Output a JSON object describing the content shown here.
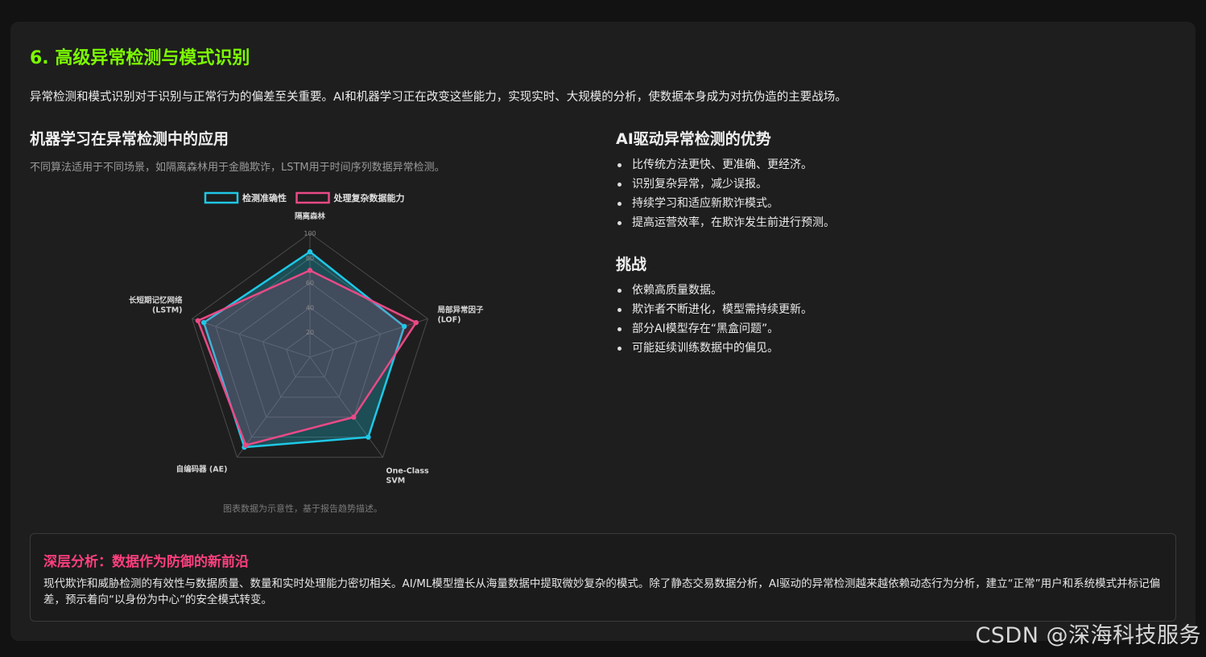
{
  "section": {
    "title": "6. 高级异常检测与模式识别",
    "intro": "异常检测和模式识别对于识别与正常行为的偏差至关重要。AI和机器学习正在改变这些能力，实现实时、大规模的分析，使数据本身成为对抗伪造的主要战场。"
  },
  "left": {
    "title": "机器学习在异常检测中的应用",
    "subtitle": "不同算法适用于不同场景，如隔离森林用于金融欺诈，LSTM用于时间序列数据异常检测。",
    "caption": "图表数据为示意性，基于报告趋势描述。"
  },
  "chart_data": {
    "type": "radar",
    "categories": [
      "隔离森林",
      "局部异常因子 (LOF)",
      "One-Class SVM",
      "自编码器 (AE)",
      "长短期记忆网络 (LSTM)"
    ],
    "category_lines": [
      [
        "隔离森林"
      ],
      [
        "局部异常因子",
        "(LOF)"
      ],
      [
        "One-Class",
        "SVM"
      ],
      [
        "自编码器 (AE)"
      ],
      [
        "长短期记忆网络",
        "(LSTM)"
      ]
    ],
    "ticks": [
      20,
      40,
      60,
      80,
      100
    ],
    "rmax": 100,
    "series": [
      {
        "name": "检测准确性",
        "values": [
          85,
          80,
          80,
          90,
          90
        ],
        "color": "#1ec8e6"
      },
      {
        "name": "处理复杂数据能力",
        "values": [
          70,
          90,
          60,
          88,
          95
        ],
        "color": "#e84a86"
      }
    ],
    "legend_position": "top"
  },
  "right": {
    "advantages_title": "AI驱动异常检测的优势",
    "advantages": [
      "比传统方法更快、更准确、更经济。",
      "识别复杂异常，减少误报。",
      "持续学习和适应新欺诈模式。",
      "提高运营效率，在欺诈发生前进行预测。"
    ],
    "challenges_title": "挑战",
    "challenges": [
      "依赖高质量数据。",
      "欺诈者不断进化，模型需持续更新。",
      "部分AI模型存在“黑盒问题”。",
      "可能延续训练数据中的偏见。"
    ]
  },
  "deep": {
    "title": "深层分析：数据作为防御的新前沿",
    "body": "现代欺诈和威胁检测的有效性与数据质量、数量和实时处理能力密切相关。AI/ML模型擅长从海量数据中提取微妙复杂的模式。除了静态交易数据分析，AI驱动的异常检测越来越依赖动态行为分析，建立“正常”用户和系统模式并标记偏差，预示着向“以身份为中心”的安全模式转变。"
  },
  "watermark": "CSDN @深海科技服务"
}
